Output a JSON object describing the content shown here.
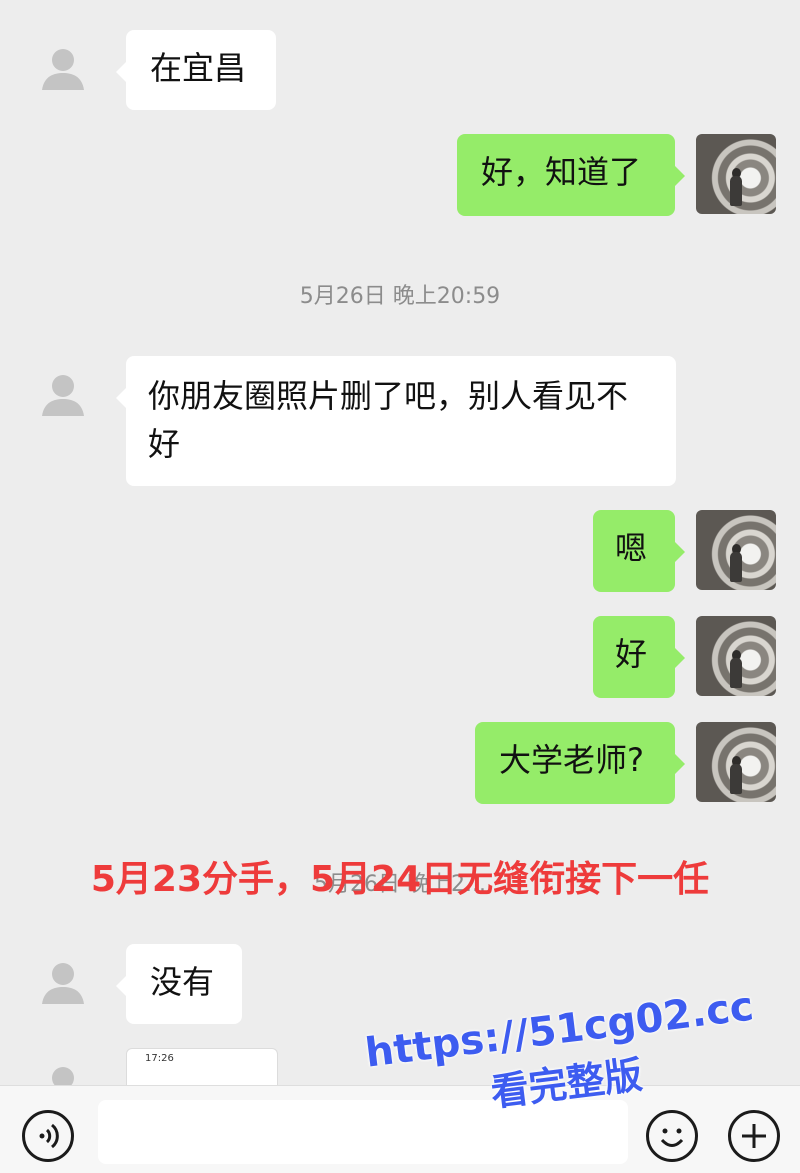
{
  "messages": [
    {
      "side": "in",
      "text": "在宜昌"
    },
    {
      "side": "out",
      "text": "好，知道了"
    },
    {
      "side": "in",
      "text": "你朋友圈照片删了吧，别人看见不好"
    },
    {
      "side": "out",
      "text": "嗯"
    },
    {
      "side": "out",
      "text": "好"
    },
    {
      "side": "out",
      "text": "大学老师?"
    },
    {
      "side": "in",
      "text": "没有"
    }
  ],
  "timestamps": {
    "first": "5月26日 晚上20:59",
    "second_partial": "5月26日 晚上2..."
  },
  "overlay_caption": "5月23分手，5月24日无缝衔接下一任",
  "preview_card": {
    "time": "17:26"
  },
  "watermark": {
    "url": "https://51cg02.cc",
    "sub": "看完整版"
  },
  "icons": {
    "voice": "voice-icon",
    "emoji": "emoji-icon",
    "plus": "plus-icon",
    "default_avatar": "default-avatar-icon"
  },
  "colors": {
    "background": "#ededed",
    "incoming_bubble": "#ffffff",
    "outgoing_bubble": "#95ec69",
    "caption_red": "#ee3b3b",
    "watermark_blue": "#3d5cf0"
  }
}
